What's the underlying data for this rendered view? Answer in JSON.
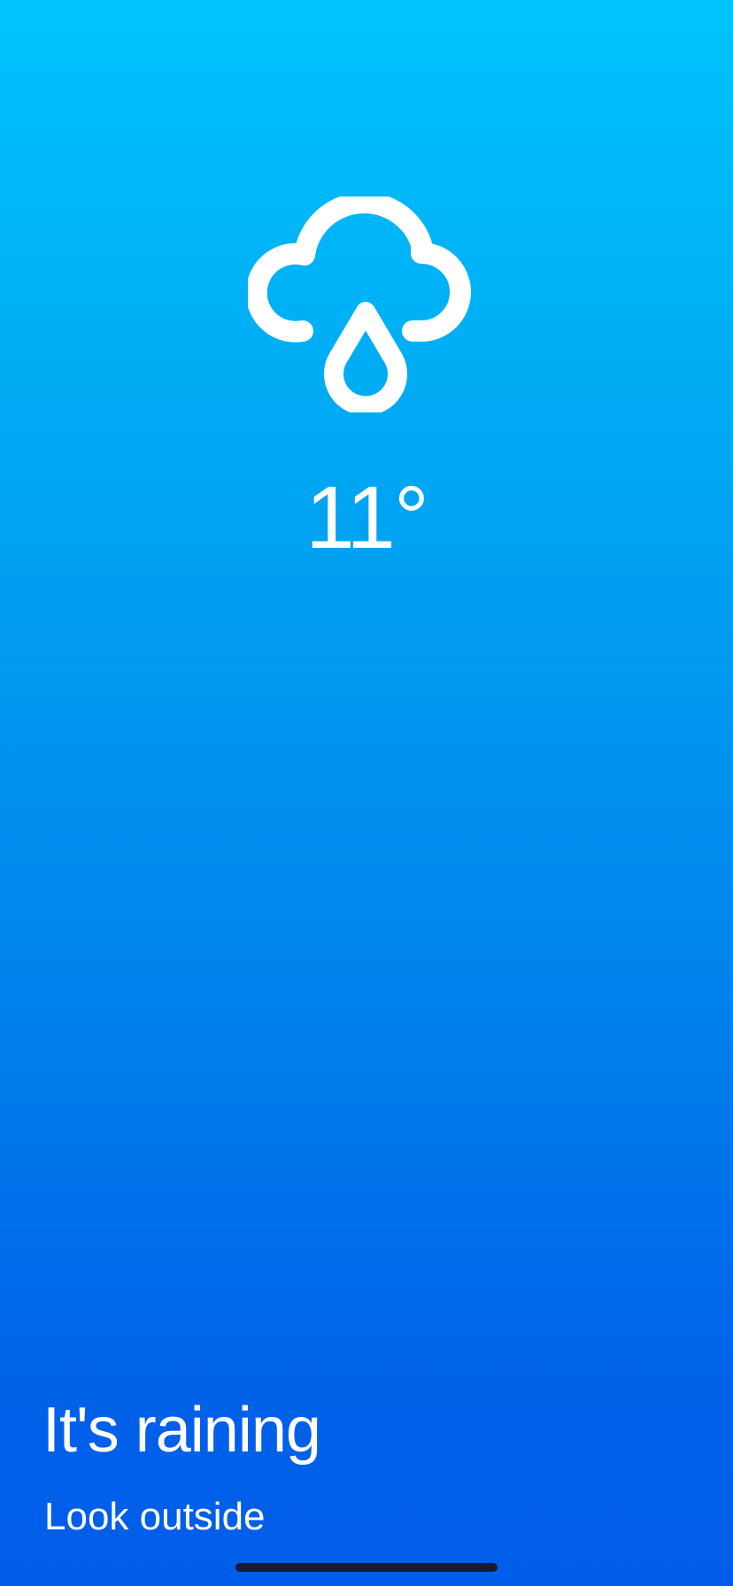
{
  "weather": {
    "icon": "cloud-rain-icon",
    "temperature": "11°",
    "headline": "It's raining",
    "subline": "Look outside"
  },
  "colors": {
    "gradient_top": "#00c3fd",
    "gradient_bottom": "#005de9",
    "text": "#ffffff",
    "home_indicator": "#1a1a2e"
  }
}
